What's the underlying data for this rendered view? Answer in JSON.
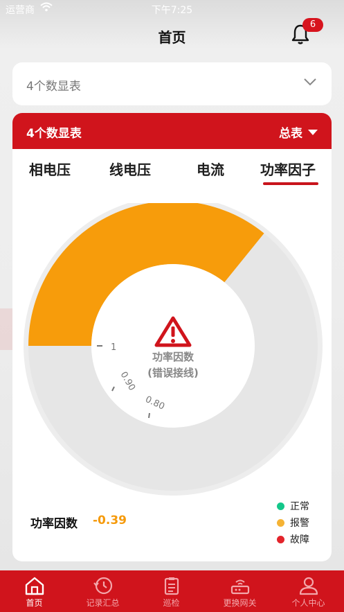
{
  "status_bar": {
    "carrier": "运营商",
    "time": "下午7:25"
  },
  "header": {
    "title": "首页",
    "notification_count": "6"
  },
  "selector": {
    "value": "4个数显表"
  },
  "card": {
    "title": "4个数显表",
    "dropdown_label": "总表",
    "tabs": [
      "相电压",
      "线电压",
      "电流",
      "功率因子"
    ],
    "active_tab": 3
  },
  "gauge": {
    "value": -0.39,
    "tick_labels": [
      "1",
      "0.90",
      "0.80"
    ],
    "center_title": "功率因数",
    "center_subtitle": "(错误接线)",
    "fill_color": "#f79c0b",
    "warning_color": "#d0141c"
  },
  "reading": {
    "label": "功率因数",
    "value": "-0.39"
  },
  "legend": [
    {
      "label": "正常",
      "color": "#14c78a"
    },
    {
      "label": "报警",
      "color": "#f5b335"
    },
    {
      "label": "故障",
      "color": "#e3242b"
    }
  ],
  "tabbar": {
    "items": [
      {
        "label": "首页",
        "icon": "home-icon"
      },
      {
        "label": "记录汇总",
        "icon": "history-icon"
      },
      {
        "label": "巡检",
        "icon": "clipboard-icon"
      },
      {
        "label": "更换网关",
        "icon": "router-icon"
      },
      {
        "label": "个人中心",
        "icon": "user-icon"
      }
    ],
    "active_index": 0
  }
}
